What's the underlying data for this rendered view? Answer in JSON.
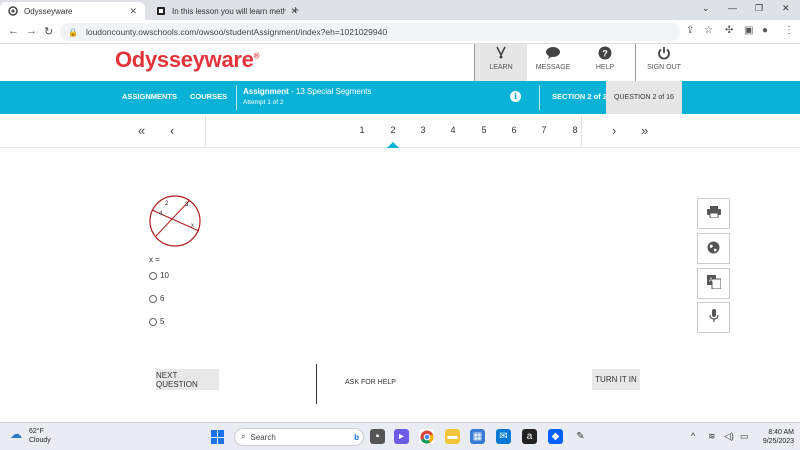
{
  "browser": {
    "tabs": [
      {
        "title": "Odysseyware",
        "active": true
      },
      {
        "title": "In this lesson you will learn meth",
        "active": false
      }
    ],
    "url": "loudoncounty.owschools.com/owsoo/studentAssignment/index?eh=1021029940"
  },
  "header": {
    "logo": "Odysseyware",
    "logo_mark": "®",
    "nav": [
      {
        "label": "LEARN",
        "icon": "learn-icon"
      },
      {
        "label": "MESSAGE",
        "icon": "message-icon"
      },
      {
        "label": "HELP",
        "icon": "help-icon"
      },
      {
        "label": "SIGN OUT",
        "icon": "power-icon"
      }
    ]
  },
  "assignment_bar": {
    "assignments": "ASSIGNMENTS",
    "courses": "COURSES",
    "assignment_label": "Assignment",
    "assignment_name": " - 13 Special Segments",
    "attempt": "Attempt 1 of 2",
    "section": "SECTION 2 of 2",
    "question": "QUESTION 2 of 16"
  },
  "pager": {
    "pages": [
      "1",
      "2",
      "3",
      "4",
      "5",
      "6",
      "7",
      "8"
    ],
    "current": "2"
  },
  "question": {
    "diagram_labels": {
      "a": "2",
      "b": "3",
      "c": "4",
      "d": "x"
    },
    "prompt": "x =",
    "options": [
      "10",
      "6",
      "5"
    ]
  },
  "tools": [
    "printer-icon",
    "globe-icon",
    "translate-icon",
    "microphone-icon"
  ],
  "buttons": {
    "next": "NEXT QUESTION",
    "help": "ASK FOR HELP",
    "turn_in": "TURN IT IN"
  },
  "taskbar": {
    "temperature": "62°F",
    "weather": "Cloudy",
    "search_placeholder": "Search",
    "time": "8:40 AM",
    "date": "9/25/2023"
  },
  "colors": {
    "brand_red": "#e2343a",
    "bar_blue": "#0ab2d7"
  }
}
